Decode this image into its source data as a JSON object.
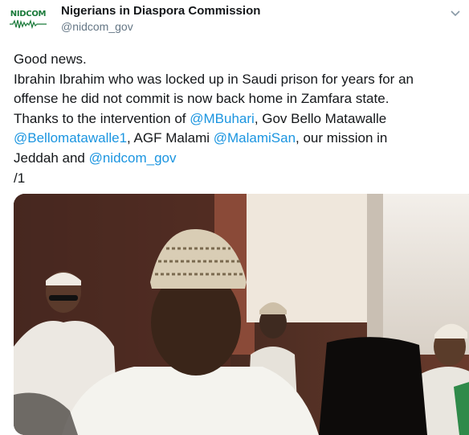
{
  "profile": {
    "avatar_text": "NIDCOM",
    "display_name": "Nigerians in Diaspora Commission",
    "handle": "@nidcom_gov"
  },
  "tweet": {
    "line1": "Good news.",
    "line2": "Ibrahin Ibrahim who was locked up in Saudi prison for years for an",
    "line3": "offense he did not commit is now back home in Zamfara state.",
    "line4_a": "Thanks to the intervention of ",
    "mention_buhari": "@MBuhari",
    "line4_b": ", Gov Bello Matawalle",
    "mention_bello": "@Bellomatawalle1",
    "line5_a": ", AGF Malami ",
    "mention_malami": "@MalamiSan",
    "line5_b": ", our mission in",
    "line6_a": "Jeddah and ",
    "mention_nidcom": "@nidcom_gov",
    "line7": "/1"
  },
  "colors": {
    "link": "#1b95e0",
    "secondary_text": "#657786",
    "brand_green": "#1a7a3a"
  },
  "icons": {
    "menu": "chevron-down-icon"
  }
}
